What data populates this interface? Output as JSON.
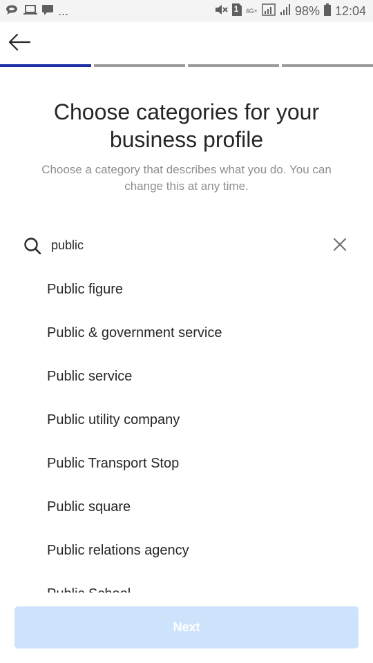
{
  "status_bar": {
    "left_icons": [
      "chat-bubble-icon",
      "laptop-icon",
      "message-icon"
    ],
    "more": "...",
    "right_icons": [
      "mute-icon",
      "sim-card-icon",
      "network-4g-icon",
      "signal-icon",
      "battery-icon"
    ],
    "sim_label": "1",
    "network_label": "4G+",
    "battery": "98%",
    "time": "12:04"
  },
  "nav": {
    "back_icon": "back-arrow-icon",
    "progress_steps": 4,
    "active_step": 1,
    "colors": {
      "active": "#1e2fa5",
      "inactive": "#9c9c9c"
    }
  },
  "header": {
    "title": "Choose categories for your business profile",
    "subtitle": "Choose a category that describes what you do. You can change this at any time."
  },
  "search": {
    "icon": "search-icon",
    "value": "public",
    "clear_icon": "close-icon"
  },
  "results": [
    "Public figure",
    "Public & government service",
    "Public service",
    "Public utility company",
    "Public Transport Stop",
    "Public square",
    "Public relations agency",
    "Public School"
  ],
  "footer": {
    "next_label": "Next",
    "next_color": "#cde3fb",
    "next_enabled": false
  }
}
